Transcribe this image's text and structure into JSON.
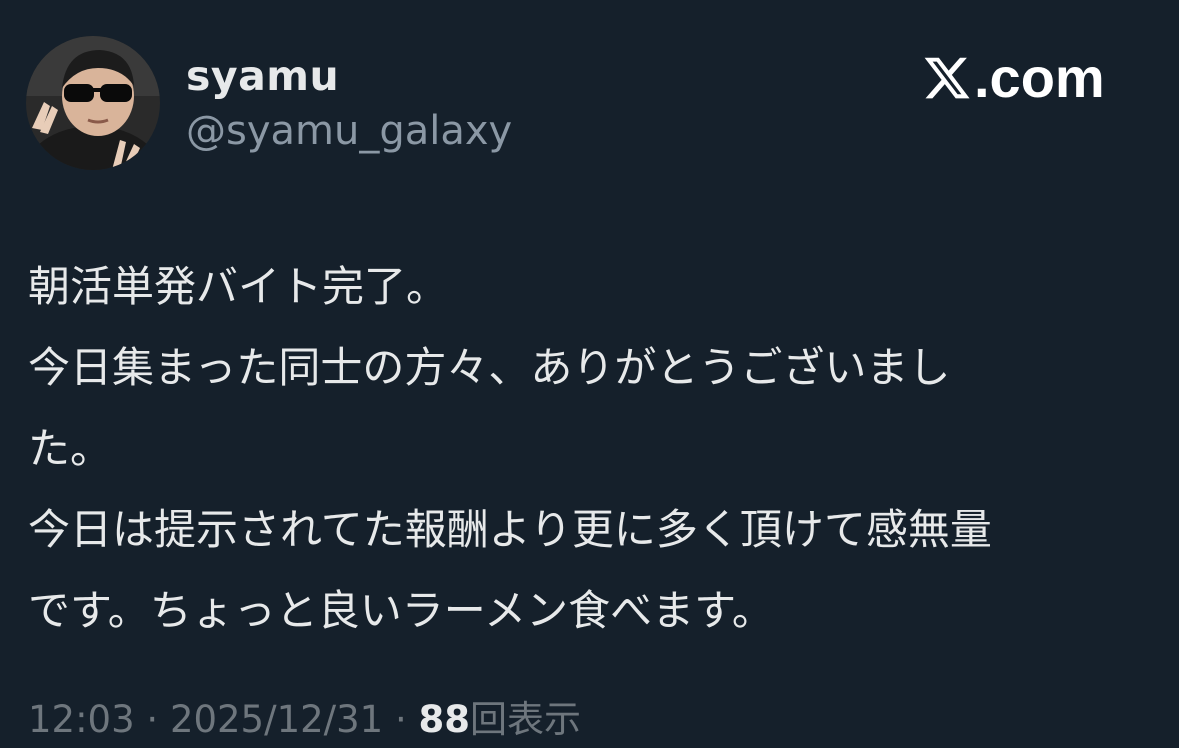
{
  "author": {
    "display_name": "syamu",
    "handle": "@syamu_galaxy"
  },
  "brand": {
    "logo_icon": "x-logo-icon",
    "text": ".com"
  },
  "tweet": {
    "lines": [
      "朝活単発バイト完了。",
      "今日集まった同士の方々、ありがとうございまし",
      "た。",
      "今日は提示されてた報酬より更に多く頂けて感無量",
      "です。ちょっと良いラーメン食べます。"
    ]
  },
  "meta": {
    "time": "12:03",
    "separator": "·",
    "date": "2025/12/31",
    "views_count": "88",
    "views_label": "回表示"
  },
  "colors": {
    "background": "#15202b",
    "primary_text": "#e7e9ea",
    "secondary_text": "#8b98a5",
    "meta_text": "#6e767d"
  }
}
